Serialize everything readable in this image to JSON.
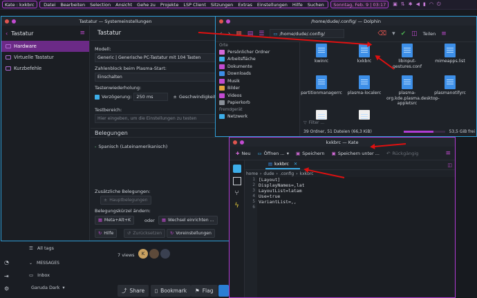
{
  "panel": {
    "active_window": "Kate : kxkbrc",
    "menu": [
      "Datei",
      "Bearbeiten",
      "Selection",
      "Ansicht",
      "Gehe zu",
      "Projekte",
      "LSP Client",
      "Sitzungen",
      "Extras",
      "Einstellungen",
      "Hilfe",
      "Suchen"
    ],
    "clock": "Sonntag, Feb. 9 | 03:17",
    "tray_icons": [
      "clipboard-icon",
      "network-icon",
      "bluetooth-icon",
      "volume-icon",
      "battery-icon",
      "wifi-icon",
      "power-icon"
    ]
  },
  "tastatur": {
    "window_title": "Tastatur — Systemeinstellungen",
    "sidebar_title": "Tastatur",
    "sidebar_items": [
      "Hardware",
      "Virtuelle Tastatur",
      "Kurzbefehle"
    ],
    "content_title": "Tastatur",
    "model_label": "Modell:",
    "model_value": "Generic | Generische PC-Tastatur mit 104 Tasten",
    "numlock_label": "Zahlenblock beim Plasma-Start:",
    "numlock_value": "Einschalten",
    "repeat_label": "Tastenwiederholung:",
    "delay_label": "Verzögerung:",
    "delay_value": "250 ms",
    "speed_label": "Geschwindigkeit:",
    "test_label": "Testbereich:",
    "test_placeholder": "Hier eingeben, um die Einstellungen zu testen",
    "layouts_title": "Belegungen",
    "layout_item": "Spanisch (Lateinamerikanisch)",
    "extra_label": "Zusätzliche Belegungen:",
    "extra_button": "Hauptbelegungen",
    "shortcut_label": "Belegungskürzel ändern:",
    "shortcut_value": "Meta+Alt+K",
    "or_label": "oder",
    "switch_button": "Wechsel einrichten ...",
    "help_button": "Hilfe",
    "reset_button": "Zurücksetzen",
    "defaults_button": "Voreinstellungen"
  },
  "dolphin": {
    "window_title": "/home/dude/.config/ — Dolphin",
    "path": "/home/dude/.config/",
    "split_label": "Teilen",
    "places_sections": [
      "Orte",
      "Fremdgerät"
    ],
    "places": [
      "Persönlicher Ordner",
      "Arbeitsfläche",
      "Dokumente",
      "Downloads",
      "Musik",
      "Bilder",
      "Videos",
      "Papierkorb"
    ],
    "remote": [
      "Netzwerk"
    ],
    "files": [
      "kwinrc",
      "kxkbrc",
      "libinput-gestures.conf",
      "mimeapps.list",
      "partitionmanagerrc",
      "plasma-localerc",
      "plasma-org.kde.plasma.desktop-appletsrc",
      "plasmanotifyrc"
    ],
    "filter_placeholder": "Filter ...",
    "status": "39 Ordner, 51 Dateien (66,3 KiB)",
    "free_space": "53,5 GiB frei"
  },
  "kate": {
    "window_title": "kxkbrc — Kate",
    "toolbar": [
      "Neu",
      "Öffnen ...",
      "Speichern",
      "Speichern unter ...",
      "Rückgängig"
    ],
    "tab": "kxkbrc",
    "breadcrumb": [
      "home",
      "dude",
      ".config",
      "kxkbrc"
    ],
    "lines": [
      "[Layout]",
      "DisplayNames=,lat",
      "LayoutList=latam",
      "Use=true",
      "VariantList=,,",
      ""
    ]
  },
  "forum": {
    "all_tags": "All tags",
    "messages": "MESSAGES",
    "inbox": "Inbox",
    "theme": "Garuda Dark",
    "views": "7 views",
    "share": "Share",
    "bookmark": "Bookmark",
    "flag": "Flag"
  }
}
